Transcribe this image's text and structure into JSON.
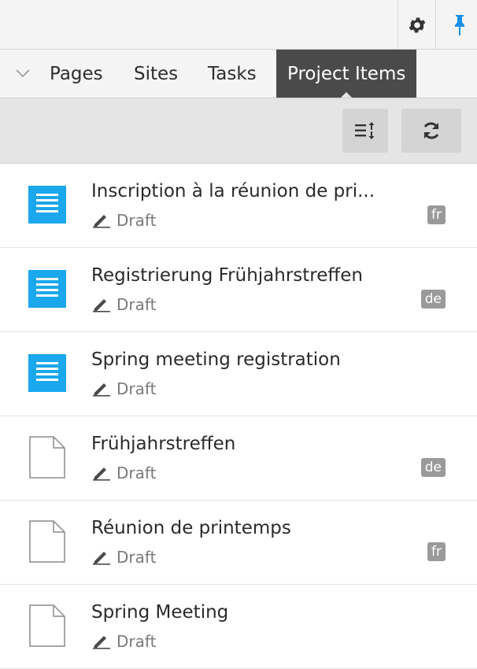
{
  "tabs": [
    {
      "label": "Pages"
    },
    {
      "label": "Sites"
    },
    {
      "label": "Tasks"
    },
    {
      "label": "Project Items",
      "active": true
    }
  ],
  "colors": {
    "accent": "#1aa7ec",
    "active_tab": "#4a4a4a",
    "pin": "#1a8fe8"
  },
  "toolbar": {
    "sort_icon": "sort-icon",
    "refresh_icon": "refresh-icon"
  },
  "items": [
    {
      "title": "Inscription à la réunion de pri...",
      "status": "Draft",
      "lang": "fr",
      "icon": "form-icon"
    },
    {
      "title": "Registrierung Frühjahrstreffen",
      "status": "Draft",
      "lang": "de",
      "icon": "form-icon"
    },
    {
      "title": "Spring meeting registration",
      "status": "Draft",
      "lang": "",
      "icon": "form-icon"
    },
    {
      "title": "Frühjahrstreffen",
      "status": "Draft",
      "lang": "de",
      "icon": "page-icon"
    },
    {
      "title": "Réunion de printemps",
      "status": "Draft",
      "lang": "fr",
      "icon": "page-icon"
    },
    {
      "title": "Spring Meeting",
      "status": "Draft",
      "lang": "",
      "icon": "page-icon"
    }
  ]
}
